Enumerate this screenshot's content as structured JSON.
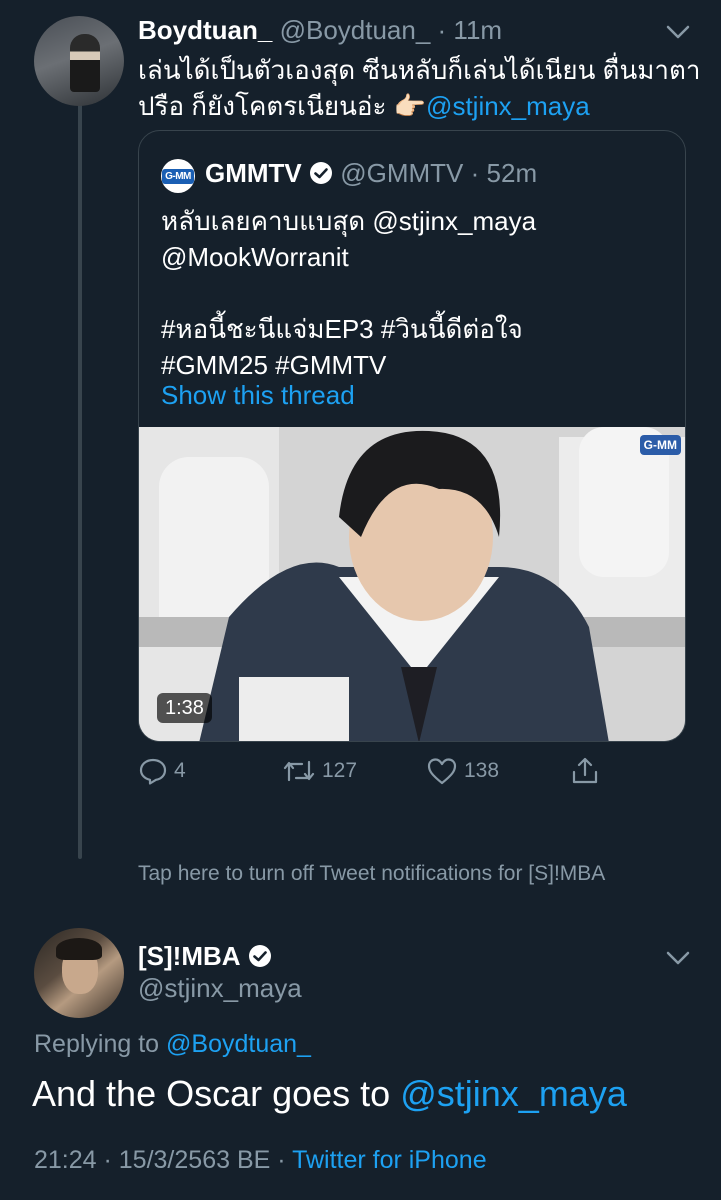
{
  "tweet1": {
    "name": "Boydtuan_",
    "handle": "@Boydtuan_",
    "time": "· 11m",
    "text_line1": "เล่นได้เป็นตัวเองสุด ซีนหลับก็เล่นได้เนียน ตื่นมาตา",
    "text_line2": "ปรือ ก็ยังโคตรเนียนอ่ะ",
    "emoji": "👉🏻",
    "mention": "@stjinx_maya",
    "avatar_icon": "profile-photo",
    "menu_icon": "chevron-down-icon"
  },
  "quoted": {
    "logo_text": "G-MM",
    "name": "GMMTV",
    "handle": "@GMMTV",
    "time": "· 52m",
    "text_line1": "หลับเลยคาบแบสุด @stjinx_maya",
    "text_line2": "@MookWorranit",
    "hashtags_line1": "#หอนี้ชะนีแจ่มEP3 #วินนี้ดีต่อใจ",
    "hashtags_line2": "#GMM25 #GMMTV",
    "show_thread": "Show this thread",
    "video": {
      "duration": "1:38",
      "logo": "G-MM"
    }
  },
  "actions": {
    "reply_count": "4",
    "retweet_count": "127",
    "like_count": "138"
  },
  "notice": "Tap here to turn off Tweet notifications for [S]!MBA",
  "tweet2": {
    "name": "[S]!MBA",
    "handle": "@stjinx_maya",
    "replying_prefix": "Replying to",
    "replying_to": "@Boydtuan_",
    "text_prefix": "And the Oscar goes to",
    "text_mention": "@stjinx_maya",
    "timestamp": "21:24 · 15/3/2563 BE ·",
    "source": "Twitter for iPhone"
  },
  "colors": {
    "background": "#15202b",
    "accent": "#1da1f2",
    "muted": "#8899a6",
    "border": "#38444d"
  }
}
